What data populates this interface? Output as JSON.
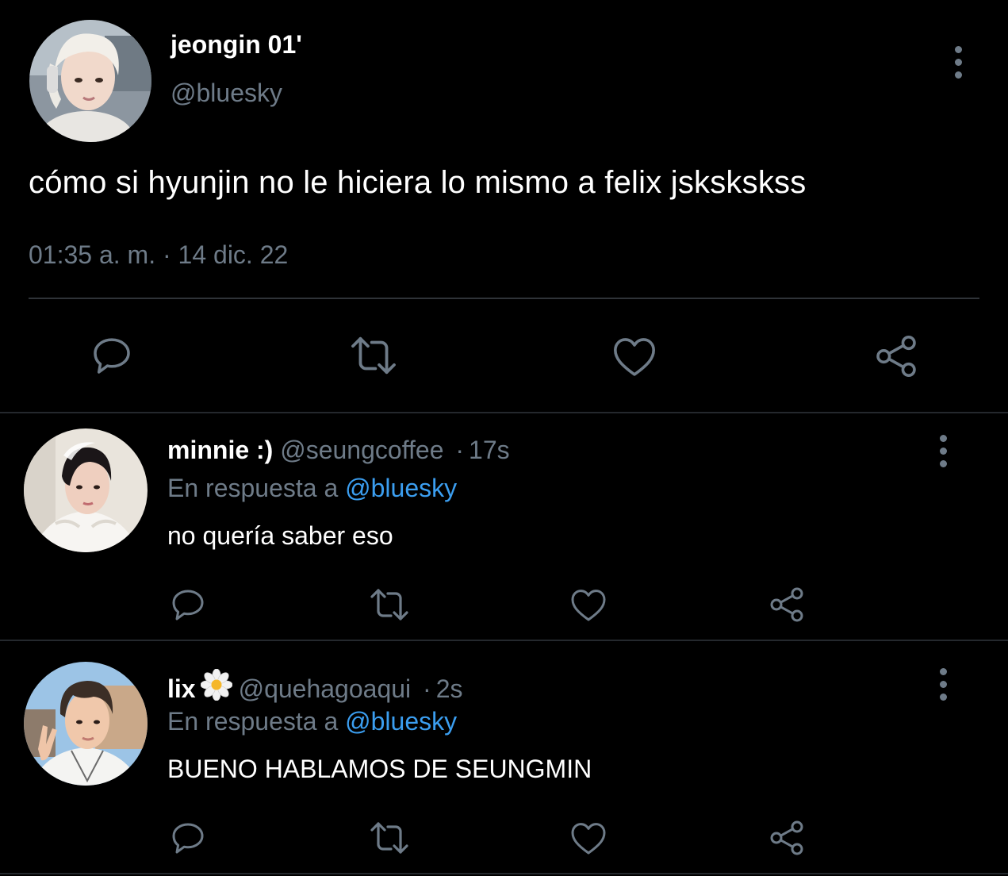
{
  "main_tweet": {
    "display_name": "jeongin 01'",
    "handle": "@bluesky",
    "text": "cómo si hyunjin no le hiciera lo mismo a felix jskskskss",
    "timestamp": "01:35 a. m. · 14 dic. 22",
    "avatar_icon": "profile-photo",
    "menu_icon": "more-vertical-icon"
  },
  "actions": {
    "reply_icon": "reply-bubble-icon",
    "retweet_icon": "retweet-icon",
    "like_icon": "heart-icon",
    "share_icon": "share-icon"
  },
  "replies": [
    {
      "display_name": "minnie :)",
      "handle": "@seungcoffee",
      "separator": "·",
      "time_ago": "17s",
      "reply_prefix": "En respuesta a",
      "reply_mention": "@bluesky",
      "text": "no quería saber eso"
    },
    {
      "display_name": "lix",
      "name_emoji": "daisy-icon",
      "handle": "@quehagoaqui",
      "separator": "·",
      "time_ago": "2s",
      "reply_prefix": "En respuesta a",
      "reply_mention": "@bluesky",
      "text": "BUENO HABLAMOS DE SEUNGMIN"
    }
  ],
  "colors": {
    "background": "#000000",
    "primary_text": "#ffffff",
    "secondary_text": "#6e7b88",
    "mention": "#3b9ef0",
    "divider": "#2f3338"
  }
}
